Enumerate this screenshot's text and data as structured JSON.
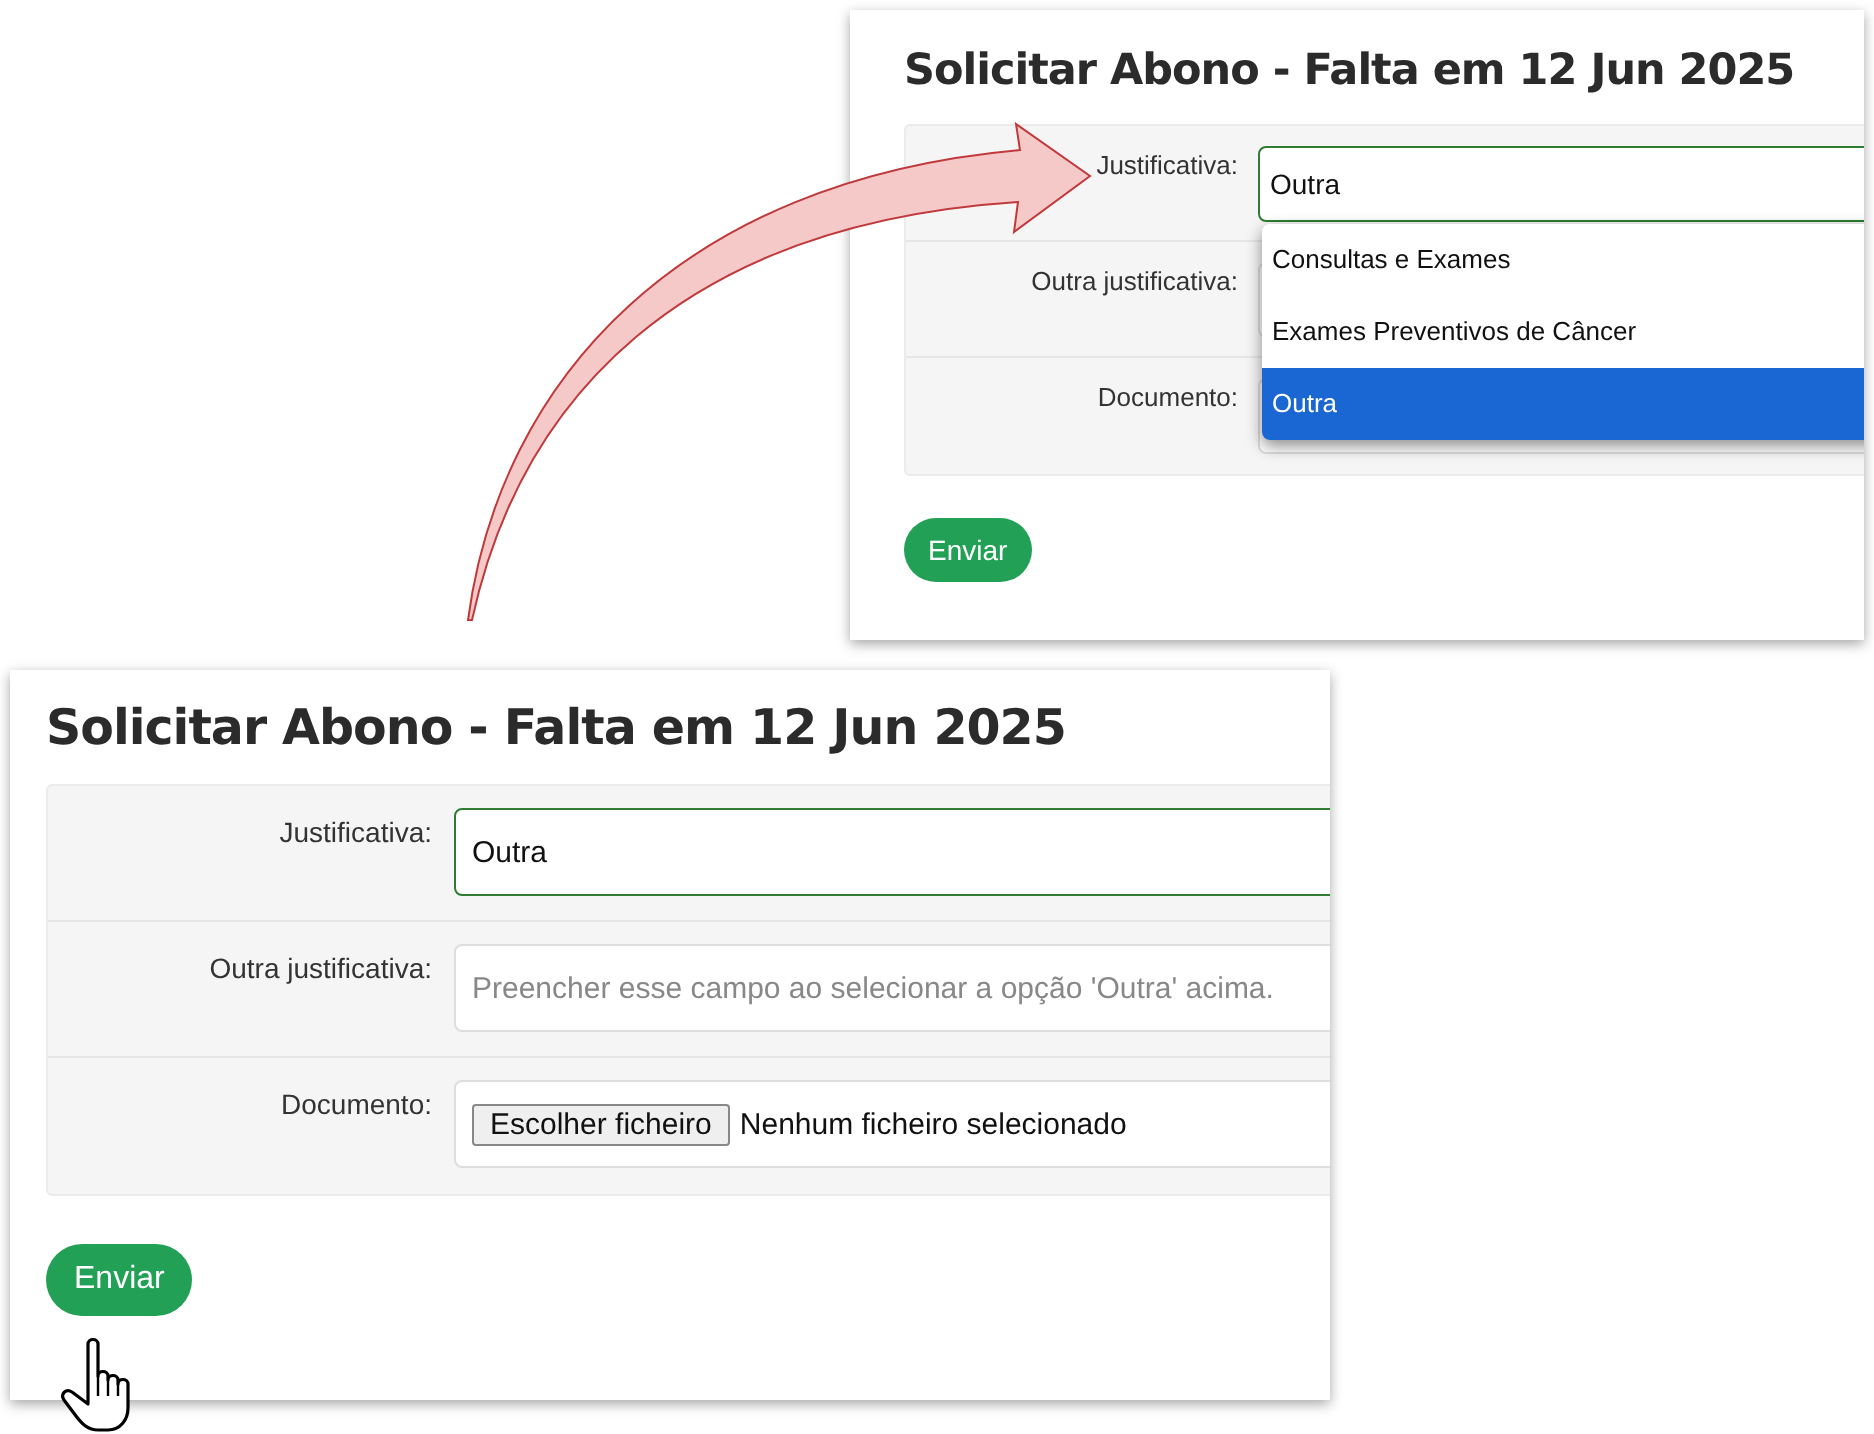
{
  "screenshots": [
    {
      "title": "Solicitar Abono - Falta em 12 Jun 2025",
      "fields": [
        {
          "kind": "select",
          "label": "Justificativa:",
          "value": "Outra",
          "dropdown": [
            {
              "label": "Consultas e Exames",
              "selected": false
            },
            {
              "label": "Exames Preventivos de Câncer",
              "selected": false
            },
            {
              "label": "Outra",
              "selected": true
            }
          ]
        },
        {
          "kind": "text",
          "label": "Outra justificativa:"
        },
        {
          "kind": "file",
          "label": "Documento:"
        }
      ],
      "submit": "Enviar",
      "cursor": false
    },
    {
      "title": "Solicitar Abono - Falta em 12 Jun 2025",
      "fields": [
        {
          "kind": "select",
          "label": "Justificativa:",
          "value": "Outra"
        },
        {
          "kind": "text",
          "label": "Outra justificativa:",
          "placeholder": "Preencher esse campo ao selecionar a opção 'Outra' acima."
        },
        {
          "kind": "file",
          "label": "Documento:",
          "button": "Escolher ficheiro",
          "status": "Nenhum ficheiro selecionado"
        }
      ],
      "submit": "Enviar",
      "cursor": true
    }
  ]
}
